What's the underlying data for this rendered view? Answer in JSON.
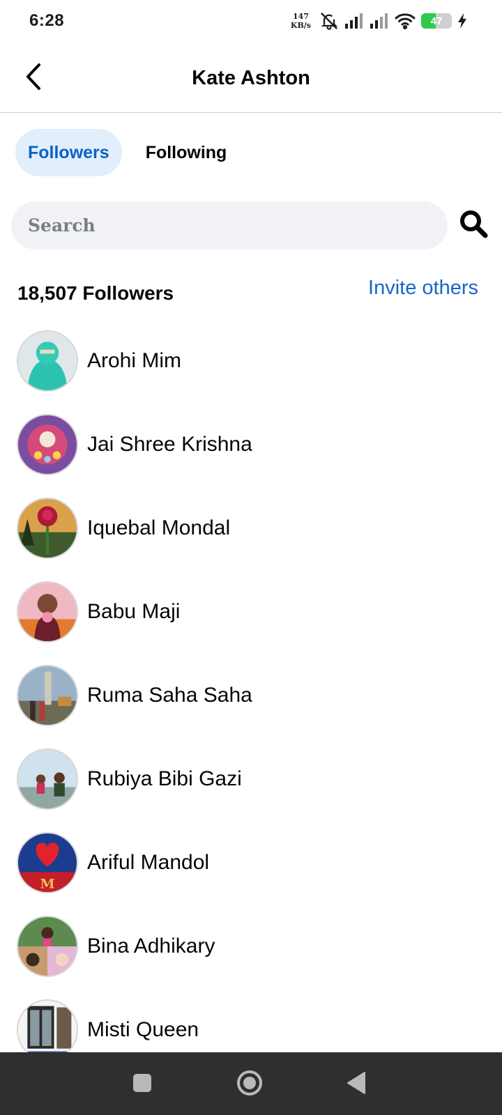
{
  "status_bar": {
    "time": "6:28",
    "net_speed_value": "147",
    "net_speed_unit": "KB/s",
    "battery_level": "47",
    "battery_fraction": 0.47,
    "battery_color": "#2fc94b",
    "icons": [
      "bell-off-icon",
      "signal-icon",
      "signal-icon",
      "wifi-icon",
      "battery-icon",
      "charging-icon"
    ]
  },
  "header": {
    "title": "Kate Ashton",
    "back_icon": "chevron-left-icon"
  },
  "tabs": [
    {
      "label": "Followers",
      "active": true
    },
    {
      "label": "Following",
      "active": false
    }
  ],
  "search": {
    "placeholder": "Search",
    "value": "",
    "icon": "search-icon"
  },
  "followers": {
    "count_label": "18,507 Followers",
    "invite_label": "Invite others",
    "items": [
      {
        "name": "Arohi Mim"
      },
      {
        "name": "Jai Shree Krishna"
      },
      {
        "name": "Iquebal Mondal"
      },
      {
        "name": "Babu Maji"
      },
      {
        "name": "Ruma Saha Saha"
      },
      {
        "name": "Rubiya Bibi Gazi"
      },
      {
        "name": "Ariful Mandol"
      },
      {
        "name": "Bina Adhikary"
      },
      {
        "name": "Misti Queen"
      }
    ]
  },
  "nav_bar": {
    "icons": [
      "recents-square-icon",
      "home-circle-icon",
      "back-triangle-icon"
    ]
  },
  "colors": {
    "accent": "#0a61c9",
    "link": "#1866c9",
    "tab_active_bg": "#e2eefc",
    "search_bg": "#f0f2f5",
    "nav_bg": "#2f2f2f"
  }
}
